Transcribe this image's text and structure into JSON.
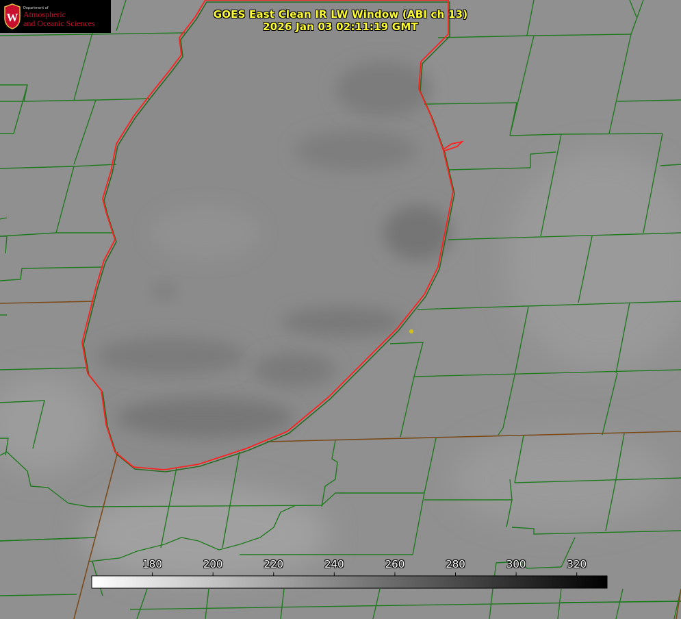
{
  "title": {
    "line1": "GOES East Clean IR LW Window (ABI ch 13)",
    "line2": "2026 Jan 03 02:11:19 GMT"
  },
  "logo": {
    "department": "Department of",
    "line1": "Atmospheric",
    "line2": "and Oceanic Sciences",
    "seal_letter": "W"
  },
  "colorbar": {
    "min": 160,
    "max": 330,
    "ticks": [
      180,
      200,
      220,
      240,
      260,
      280,
      300,
      320
    ],
    "tick_labels": [
      "180",
      "200",
      "220",
      "240",
      "260",
      "280",
      "300",
      "320"
    ],
    "gradient": "white-to-black"
  },
  "colors": {
    "county_lines": "#1f7a1f",
    "state_lines": "#7a4a1a",
    "shoreline": "#ff2020",
    "title": "#ffff33",
    "marker": "#d4c21a",
    "lake_gray": "#8c8c8c",
    "land_gray": "#909090",
    "logo_red": "#c8102e"
  },
  "map": {
    "feature": "lake-outline",
    "marker": "station-dot"
  }
}
